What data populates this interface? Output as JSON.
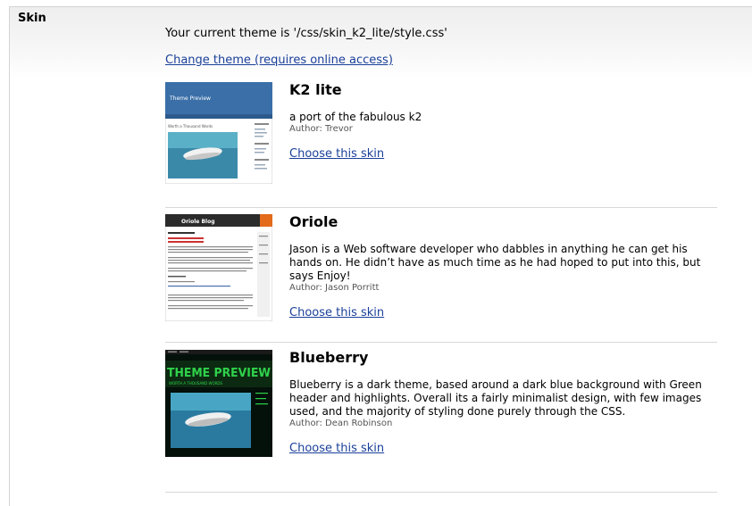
{
  "section_label": "Skin",
  "current_theme": "Your current theme is '/css/skin_k2_lite/style.css'",
  "change_theme_link": "Change theme (requires online access)",
  "skins": [
    {
      "name": "K2 lite",
      "description": "a port of the fabulous k2",
      "author": "Author: Trevor",
      "choose_label": "Choose this skin",
      "preview_title": "Theme Preview",
      "preview_post": "Worth a Thousand Words"
    },
    {
      "name": "Oriole",
      "description": "Jason is a Web software developer who dabbles in anything he can get his hands on. He didn’t have as much time as he had hoped to put into this, but says Enjoy!",
      "author": "Author: Jason Porritt",
      "choose_label": "Choose this skin",
      "preview_title": "Oriole Blog"
    },
    {
      "name": "Blueberry",
      "description": "Blueberry is a dark theme, based around a dark blue background with Green header and highlights. Overall its a fairly minimalist design, with few images used, and the majority of styling done purely through the CSS.",
      "author": "Author: Dean Robinson",
      "choose_label": "Choose this skin",
      "preview_title": "THEME PREVIEW",
      "preview_post": "WORTH A THOUSAND WORDS"
    }
  ],
  "colors": {
    "link": "#1a3f9a",
    "k2_header": "#3a6fa8",
    "blueberry_green": "#2fd24a"
  }
}
